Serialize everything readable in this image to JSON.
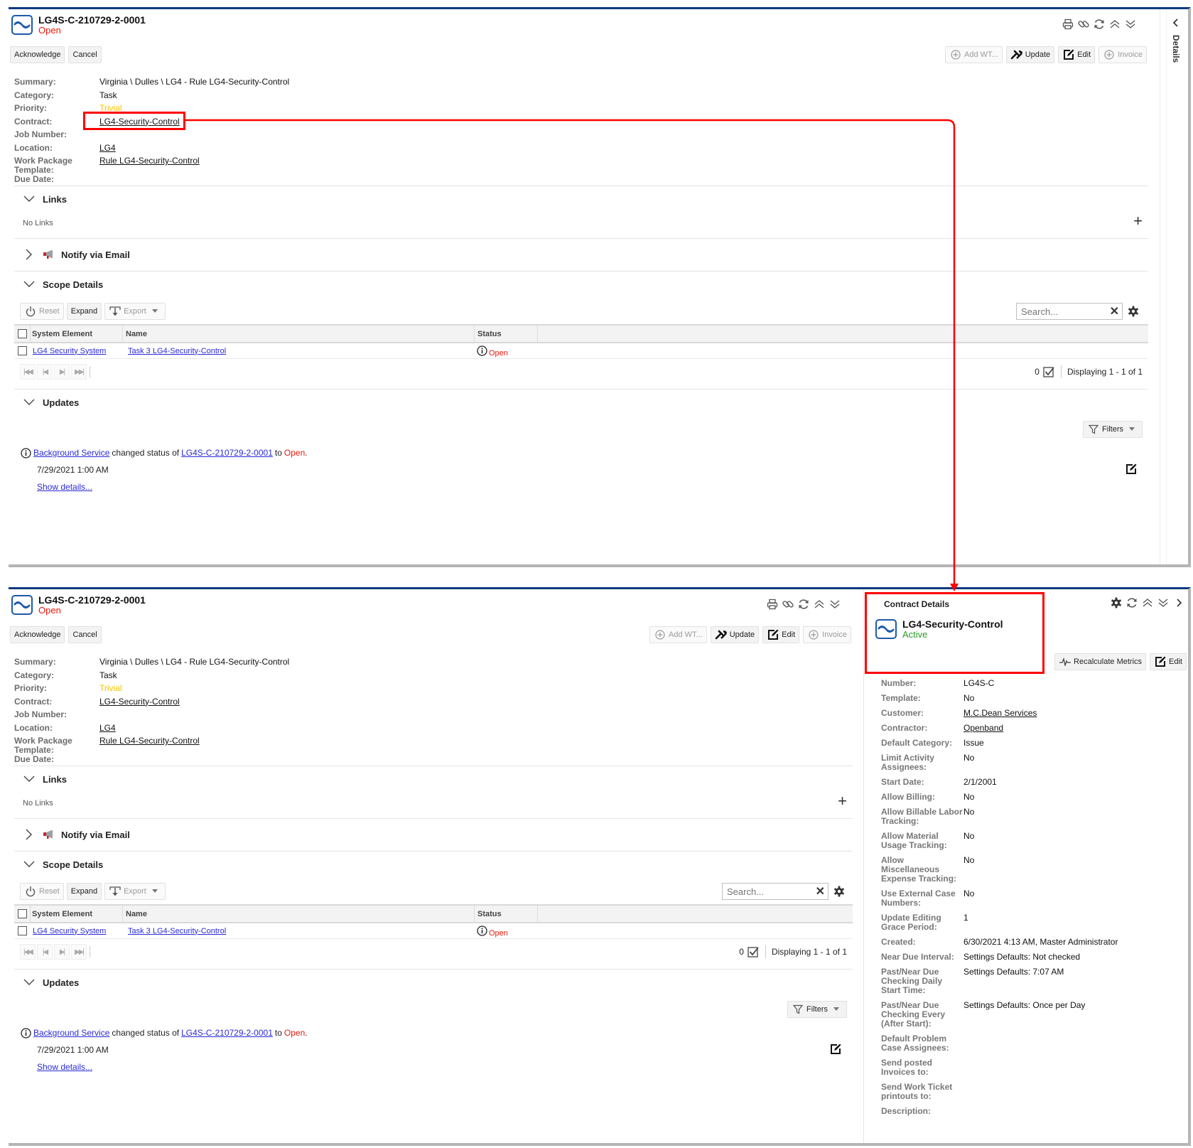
{
  "case": {
    "id": "LG4S-C-210729-2-0001",
    "status": "Open",
    "actions_left": [
      "Acknowledge",
      "Cancel"
    ],
    "actions_right": {
      "add_wt": "Add WT...",
      "update": "Update",
      "edit": "Edit",
      "invoice": "Invoice"
    },
    "tool_icons": [
      "print-icon",
      "link-icon",
      "refresh-icon",
      "collapse-all-icon",
      "expand-all-icon"
    ],
    "fields": [
      {
        "label": "Summary:",
        "value": "Virginia \\ Dulles \\ LG4 - Rule LG4-Security-Control",
        "type": "text"
      },
      {
        "label": "Category:",
        "value": "Task",
        "type": "text"
      },
      {
        "label": "Priority:",
        "value": "Trivial",
        "type": "priority"
      },
      {
        "label": "Contract:",
        "value": "LG4-Security-Control",
        "type": "link"
      },
      {
        "label": "Job Number:",
        "value": "",
        "type": "text"
      },
      {
        "label": "Location:",
        "value": "LG4",
        "type": "link"
      },
      {
        "label": "Work Package Template:",
        "value": "Rule LG4-Security-Control",
        "type": "link"
      },
      {
        "label": "Due Date:",
        "value": "",
        "type": "text"
      }
    ],
    "sections": {
      "links": {
        "title": "Links",
        "empty_text": "No Links",
        "add_label": "+"
      },
      "notify": {
        "title": "Notify via Email"
      },
      "scope": {
        "title": "Scope Details",
        "toolbar": {
          "reset": "Reset",
          "expand": "Expand",
          "export": "Export"
        },
        "search_placeholder": "Search...",
        "columns": [
          "System Element",
          "Name",
          "Status"
        ],
        "rows": [
          {
            "system_element": "LG4 Security System",
            "name": "Task 3 LG4-Security-Control",
            "status": "Open"
          }
        ],
        "selected_count": "0",
        "display_text": "Displaying 1 - 1 of 1"
      },
      "updates": {
        "title": "Updates",
        "filters_label": "Filters",
        "entries": [
          {
            "actor": "Background Service",
            "verb": "changed status of",
            "target": "LG4S-C-210729-2-0001",
            "to_text": "to",
            "new_status": "Open",
            "timestamp": "7/29/2021 1:00 AM",
            "show_details": "Show details..."
          }
        ]
      }
    }
  },
  "details_tab": {
    "label": "Details"
  },
  "contract_panel": {
    "heading": "Contract Details",
    "name": "LG4-Security-Control",
    "status": "Active",
    "actions": {
      "recalculate": "Recalculate Metrics",
      "edit": "Edit"
    },
    "fields": [
      {
        "label": "Number:",
        "value": "LG4S-C",
        "type": "text"
      },
      {
        "label": "Template:",
        "value": "No",
        "type": "text"
      },
      {
        "label": "Customer:",
        "value": "M.C.Dean Services",
        "type": "link"
      },
      {
        "label": "Contractor:",
        "value": "Openband",
        "type": "link"
      },
      {
        "label": "Default Category:",
        "value": "Issue",
        "type": "text"
      },
      {
        "label": "Limit Activity Assignees:",
        "value": "No",
        "type": "text"
      },
      {
        "label": "Start Date:",
        "value": "2/1/2001",
        "type": "text"
      },
      {
        "label": "Allow Billing:",
        "value": "No",
        "type": "text"
      },
      {
        "label": "Allow Billable Labor Tracking:",
        "value": "No",
        "type": "text"
      },
      {
        "label": "Allow Material Usage Tracking:",
        "value": "No",
        "type": "text"
      },
      {
        "label": "Allow Miscellaneous Expense Tracking:",
        "value": "No",
        "type": "text"
      },
      {
        "label": "Use External Case Numbers:",
        "value": "No",
        "type": "text"
      },
      {
        "label": "Update Editing Grace Period:",
        "value": "1",
        "type": "text"
      },
      {
        "label": "Created:",
        "value": "6/30/2021 4:13 AM, Master Administrator",
        "type": "text"
      },
      {
        "label": "Near Due Interval:",
        "value": "Settings Defaults: Not checked",
        "type": "text"
      },
      {
        "label": "Past/Near Due Checking Daily Start Time:",
        "value": "Settings Defaults: 7:07 AM",
        "type": "text"
      },
      {
        "label": "Past/Near Due Checking Every (After Start):",
        "value": "Settings Defaults: Once per Day",
        "type": "text"
      },
      {
        "label": "Default Problem Case Assignees:",
        "value": "",
        "type": "text"
      },
      {
        "label": "Send posted Invoices to:",
        "value": "",
        "type": "text"
      },
      {
        "label": "Send Work Ticket printouts to:",
        "value": "",
        "type": "text"
      },
      {
        "label": "Description:",
        "value": "",
        "type": "text"
      }
    ]
  },
  "colors": {
    "header_bar": "#0a3a82",
    "status_open": "#e8180c",
    "status_active": "#2a9a2a",
    "priority_trivial": "#f5c400",
    "link": "#2a2ad6",
    "annotation": "#ff0000"
  }
}
